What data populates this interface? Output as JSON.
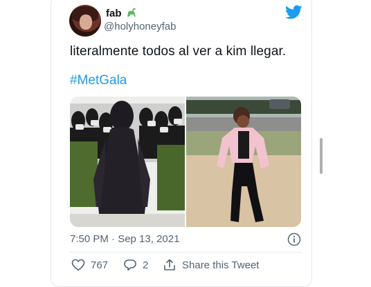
{
  "user": {
    "display_name": "fab",
    "handle": "@holyhoneyfab",
    "name_emoji": "dinosaur-icon"
  },
  "tweet": {
    "text": "literalmente todos al ver a kim llegar.",
    "hashtag": "#MetGala",
    "timestamp": "7:50 PM · Sep 13, 2021"
  },
  "media": {
    "left_image": "met-gala-photo",
    "right_image": "laughing-woman-meme"
  },
  "actions": {
    "like_count": "767",
    "reply_count": "2",
    "share_label": "Share this Tweet"
  },
  "colors": {
    "brand_blue": "#1d9bf0",
    "secondary_text": "#536471"
  }
}
